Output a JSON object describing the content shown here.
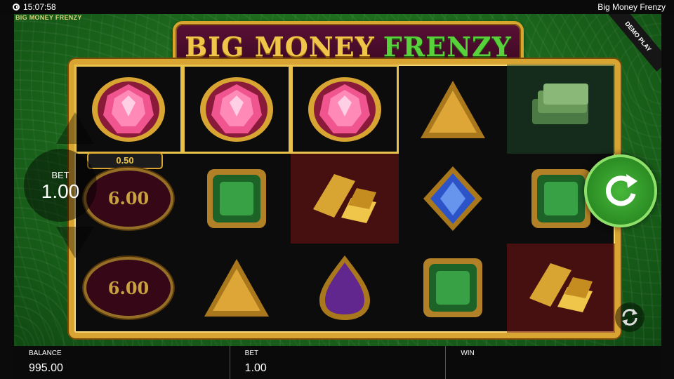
{
  "status": {
    "time": "15:07:58",
    "title": "Big Money Frenzy"
  },
  "game": {
    "brand_small": "BIG MONEY FRENZY",
    "demo_label": "DEMO PLAY",
    "logo": {
      "word1": "BIG MONEY",
      "word2": "FRENZY"
    },
    "bet": {
      "label": "BET",
      "value": "1.00"
    },
    "spin_icon": "spin-arrow-icon",
    "autoplay_icon": "autoplay-icon",
    "win_label": "0.50",
    "coins": [
      "6.00",
      "6.00"
    ],
    "reels": [
      [
        "pink-gem",
        "coin",
        "coin"
      ],
      [
        "pink-gem",
        "green-emerald",
        "gold-triangle"
      ],
      [
        "pink-gem",
        "gold-bars",
        "purple-drop"
      ],
      [
        "gold-triangle",
        "blue-diamond",
        "green-emerald"
      ],
      [
        "money-stack",
        "green-emerald",
        "gold-bars"
      ]
    ],
    "colors": {
      "gold": "#d9a532",
      "green": "#58d23a",
      "pink": "#e23a78"
    }
  },
  "footer": {
    "balance_label": "BALANCE",
    "balance_value": "995.00",
    "bet_label": "BET",
    "bet_value": "1.00",
    "win_label": "WIN",
    "win_value": ""
  }
}
